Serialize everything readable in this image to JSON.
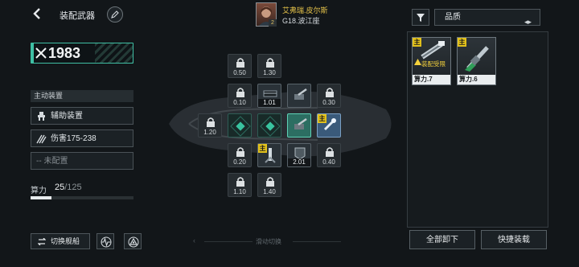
{
  "header": {
    "title": "装配武器",
    "pilot_name": "艾弗瑞.皮尔斯",
    "pilot_level": "2",
    "ship_model": "G18.波江座"
  },
  "left": {
    "power_value": "1983",
    "section_title": "主动装置",
    "slots": [
      {
        "label": "辅助装置",
        "icon": "device-icon"
      },
      {
        "label": "伤害175-238",
        "icon": "damage-icon"
      },
      {
        "label": "-- 未配置",
        "icon": ""
      }
    ],
    "cost_label": "算力",
    "cost_used": "25",
    "cost_total": "/125",
    "cost_fraction": 0.2,
    "switch_ship_label": "切换舰船"
  },
  "center": {
    "slide_hint": "滑动切换",
    "cells": {
      "r0c0": "0.50",
      "r0c1": "1.30",
      "r1c0": "0.10",
      "r1c1": "1.01",
      "r1c3": "0.30",
      "r2c_1": "1.20",
      "r3c0": "0.20",
      "r3c2": "2.01",
      "r3c3": "0.40",
      "r4c0": "1.10",
      "r4c1": "1.40"
    },
    "main_badge": "主"
  },
  "right": {
    "quality_label": "品质",
    "cards": [
      {
        "badge": "主",
        "warning": "装配受限",
        "label": "算力.7"
      },
      {
        "badge": "主",
        "label": "算力.6"
      }
    ],
    "unequip_all": "全部卸下",
    "quick_equip": "快捷装载"
  },
  "colors": {
    "accent": "#3fbfa4",
    "badge": "#e3c21b",
    "warning": "#f5d23c",
    "pilot_name": "#e7c44a"
  }
}
